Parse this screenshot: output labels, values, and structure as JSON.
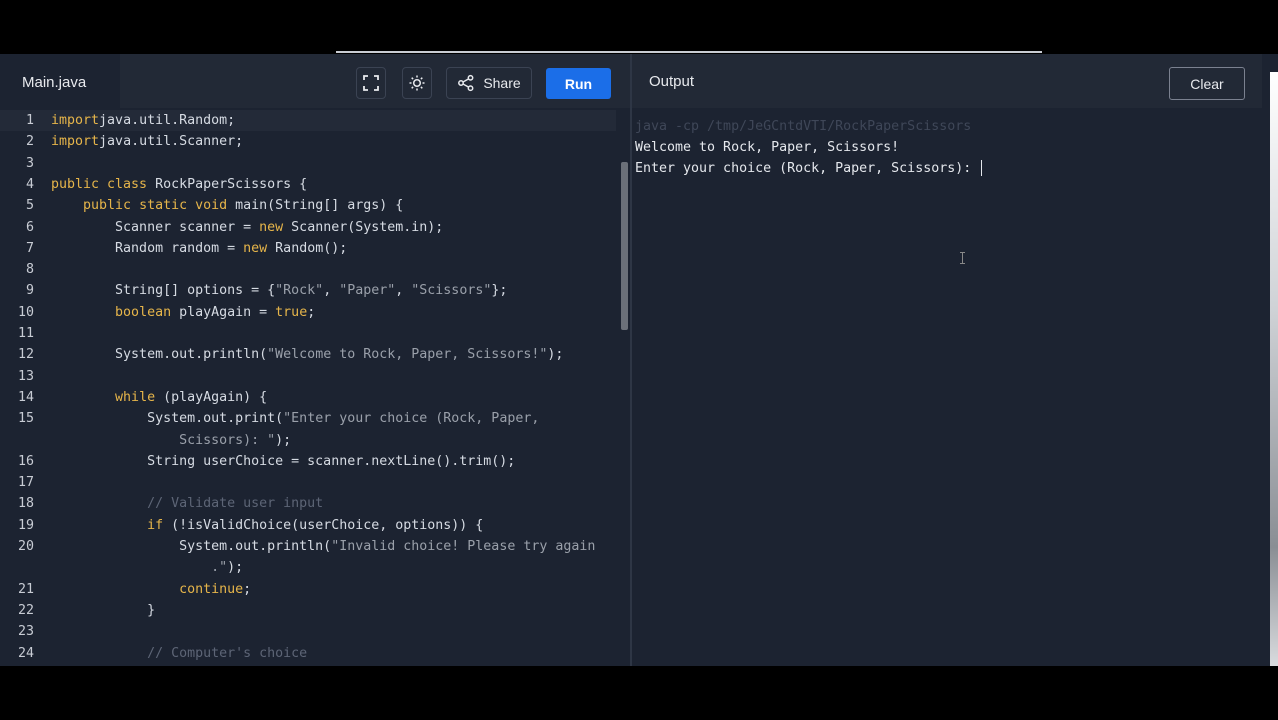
{
  "editor": {
    "tab_label": "Main.java",
    "share_label": "Share",
    "run_label": "Run",
    "icons": {
      "fullscreen": "fullscreen-icon",
      "theme": "sun-icon",
      "share": "share-icon"
    },
    "lines": [
      {
        "n": "1",
        "tokens": [
          [
            "kw",
            "import"
          ],
          [
            "",
            "java.util.Random;"
          ]
        ]
      },
      {
        "n": "2",
        "tokens": [
          [
            "kw",
            "import"
          ],
          [
            "",
            "java.util.Scanner;"
          ]
        ]
      },
      {
        "n": "3",
        "tokens": []
      },
      {
        "n": "4",
        "tokens": [
          [
            "kw",
            "public class"
          ],
          [
            "",
            " RockPaperScissors {"
          ]
        ]
      },
      {
        "n": "5",
        "tokens": [
          [
            "",
            "    "
          ],
          [
            "kw",
            "public static void"
          ],
          [
            "",
            " main(String[] args) {"
          ]
        ]
      },
      {
        "n": "6",
        "tokens": [
          [
            "",
            "        Scanner scanner = "
          ],
          [
            "kw",
            "new"
          ],
          [
            "",
            " Scanner(System.in);"
          ]
        ]
      },
      {
        "n": "7",
        "tokens": [
          [
            "",
            "        Random random = "
          ],
          [
            "kw",
            "new"
          ],
          [
            "",
            " Random();"
          ]
        ]
      },
      {
        "n": "8",
        "tokens": []
      },
      {
        "n": "9",
        "tokens": [
          [
            "",
            "        String[] options = {"
          ],
          [
            "str",
            "\"Rock\""
          ],
          [
            "",
            ", "
          ],
          [
            "str",
            "\"Paper\""
          ],
          [
            "",
            ", "
          ],
          [
            "str",
            "\"Scissors\""
          ],
          [
            "",
            "};"
          ]
        ]
      },
      {
        "n": "10",
        "tokens": [
          [
            "",
            "        "
          ],
          [
            "kw",
            "boolean"
          ],
          [
            "",
            " playAgain = "
          ],
          [
            "kw",
            "true"
          ],
          [
            "",
            ";"
          ]
        ]
      },
      {
        "n": "11",
        "tokens": []
      },
      {
        "n": "12",
        "tokens": [
          [
            "",
            "        System.out.println("
          ],
          [
            "str",
            "\"Welcome to Rock, Paper, Scissors!\""
          ],
          [
            "",
            ");"
          ]
        ]
      },
      {
        "n": "13",
        "tokens": []
      },
      {
        "n": "14",
        "tokens": [
          [
            "",
            "        "
          ],
          [
            "kw",
            "while"
          ],
          [
            "",
            " (playAgain) {"
          ]
        ]
      },
      {
        "n": "15",
        "tokens": [
          [
            "",
            "            System.out.print("
          ],
          [
            "str",
            "\"Enter your choice (Rock, Paper,"
          ]
        ]
      },
      {
        "n": "",
        "tokens": [
          [
            "str",
            "                Scissors): \""
          ],
          [
            "",
            ");"
          ]
        ]
      },
      {
        "n": "16",
        "tokens": [
          [
            "",
            "            String userChoice = scanner.nextLine().trim();"
          ]
        ]
      },
      {
        "n": "17",
        "tokens": []
      },
      {
        "n": "18",
        "tokens": [
          [
            "cm",
            "            // Validate user input"
          ]
        ]
      },
      {
        "n": "19",
        "tokens": [
          [
            "",
            "            "
          ],
          [
            "kw",
            "if"
          ],
          [
            "",
            " (!isValidChoice(userChoice, options)) {"
          ]
        ]
      },
      {
        "n": "20",
        "tokens": [
          [
            "",
            "                System.out.println("
          ],
          [
            "str",
            "\"Invalid choice! Please try again"
          ]
        ]
      },
      {
        "n": "",
        "tokens": [
          [
            "str",
            "                    .\""
          ],
          [
            "",
            ");"
          ]
        ]
      },
      {
        "n": "21",
        "tokens": [
          [
            "",
            "                "
          ],
          [
            "kw",
            "continue"
          ],
          [
            "",
            ";"
          ]
        ]
      },
      {
        "n": "22",
        "tokens": [
          [
            "",
            "            }"
          ]
        ]
      },
      {
        "n": "23",
        "tokens": []
      },
      {
        "n": "24",
        "tokens": [
          [
            "cm",
            "            // Computer's choice"
          ]
        ]
      }
    ]
  },
  "output": {
    "title": "Output",
    "clear_label": "Clear",
    "command": "java -cp /tmp/JeGCntdVTI/RockPaperScissors",
    "lines": [
      "Welcome to Rock, Paper, Scissors!",
      "Enter your choice (Rock, Paper, Scissors): "
    ]
  },
  "colors": {
    "run_button": "#1b6ee8",
    "keyword": "#e6b54a",
    "string": "#9aa0aa",
    "comment": "#5d6576"
  }
}
